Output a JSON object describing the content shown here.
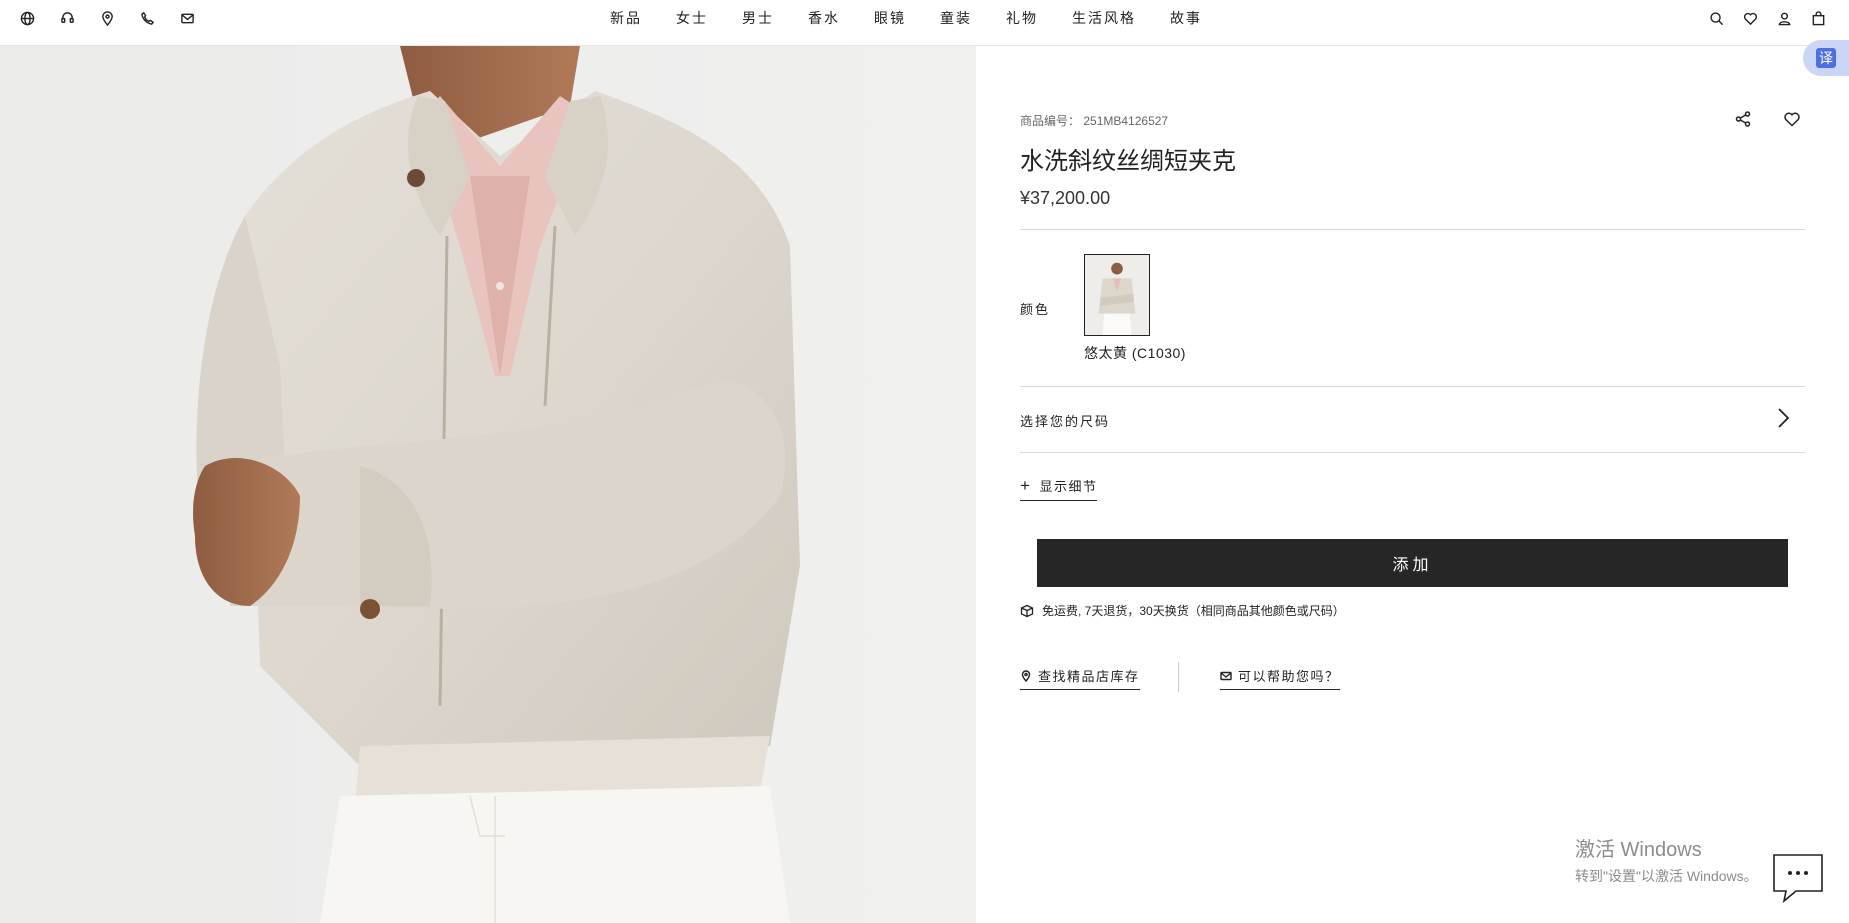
{
  "header": {
    "left_icons": [
      "globe-icon",
      "customer-service-icon",
      "location-pin-icon",
      "phone-icon",
      "mail-icon"
    ],
    "nav": [
      "新品",
      "女士",
      "男士",
      "香水",
      "眼镜",
      "童装",
      "礼物",
      "生活风格",
      "故事"
    ],
    "right_icons": [
      "search-icon",
      "wishlist-icon",
      "account-icon",
      "bag-icon"
    ]
  },
  "product": {
    "sku_label": "商品编号：",
    "sku": "251MB4126527",
    "title": "水洗斜纹丝绸短夹克",
    "price": "¥37,200.00",
    "color_label": "颜色",
    "color_name": "悠太黄 (C1030)",
    "size_label": "选择您的尺码",
    "details_label": "显示细节",
    "add_label": "添加",
    "shipping": "免运费, 7天退货，30天换货（相同商品其他颜色或尺码）",
    "store_stock": "查找精品店库存",
    "help": "可以帮助您吗？"
  },
  "overlay": {
    "translate": "译",
    "win_title": "激活 Windows",
    "win_sub": "转到\"设置\"以激活 Windows。"
  },
  "colors": {
    "accent_dark": "#262626",
    "translate_bg": "#cbd5f6",
    "translate_icon": "#4f6fe0"
  }
}
